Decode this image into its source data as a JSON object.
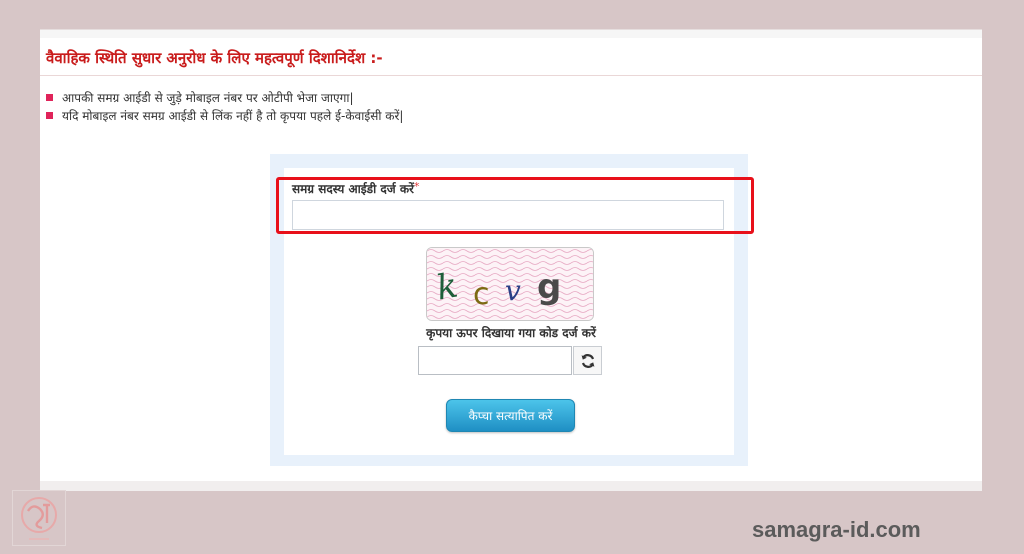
{
  "page": {
    "title": "वैवाहिक स्थिति सुधार अनुरोध के लिए महत्वपूर्ण दिशानिर्देश :-",
    "guidelines": [
      "आपकी समग्र आईडी से जुड़े मोबाइल नंबर पर ओटीपी भेजा जाएगा|",
      "यदि मोबाइल नंबर समग्र आईडी से लिंक नहीं है तो कृपया पहले ई-केवाईसी करें|"
    ]
  },
  "form": {
    "id_label": "समग्र सदस्य आईडी दर्ज करें",
    "required_mark": "*",
    "id_value": "",
    "captcha_text": "k c v g",
    "captcha_hint": "कृपया ऊपर दिखाया गया कोड दर्ज करें",
    "captcha_value": "",
    "verify_button": "कैप्चा सत्यापित करें"
  },
  "watermark": "samagra-id.com",
  "colors": {
    "title": "#c91c1c",
    "bullet": "#e0245a",
    "highlight": "#e8101a",
    "button": "#1f8fc4",
    "background": "#d7c6c7"
  }
}
